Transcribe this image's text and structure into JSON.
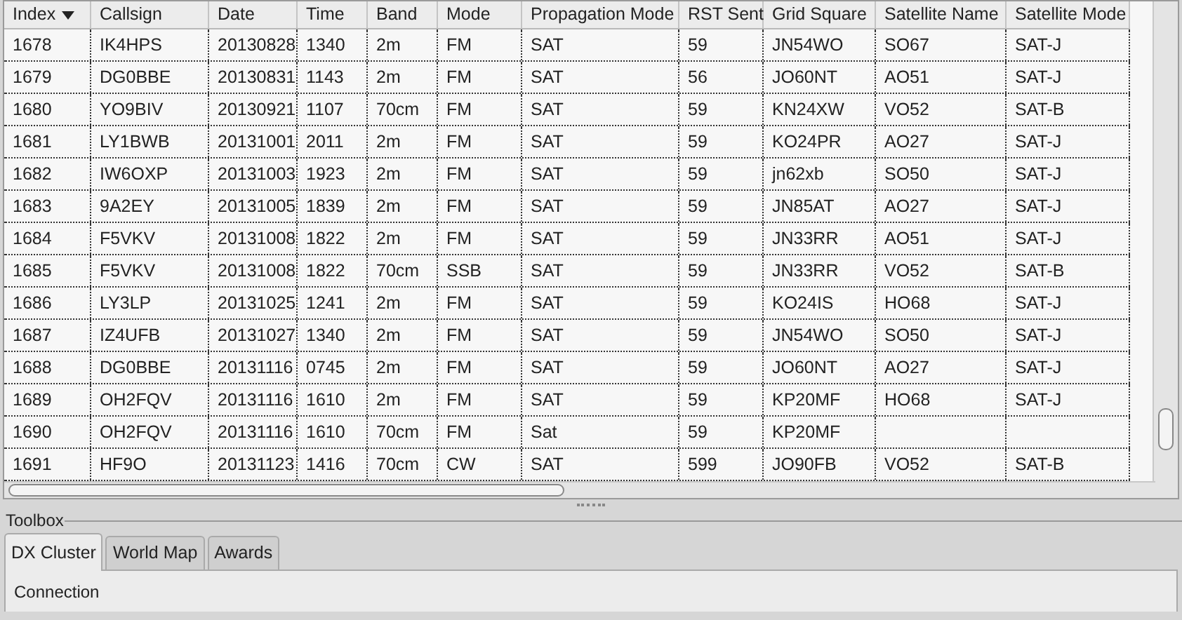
{
  "table": {
    "columns": [
      {
        "label": "Index",
        "sorted": true
      },
      {
        "label": "Callsign",
        "sorted": false
      },
      {
        "label": "Date",
        "sorted": false
      },
      {
        "label": "Time",
        "sorted": false
      },
      {
        "label": "Band",
        "sorted": false
      },
      {
        "label": "Mode",
        "sorted": false
      },
      {
        "label": "Propagation Mode",
        "sorted": false
      },
      {
        "label": "RST Sent",
        "sorted": false
      },
      {
        "label": "Grid Square",
        "sorted": false
      },
      {
        "label": "Satellite Name",
        "sorted": false
      },
      {
        "label": "Satellite Mode",
        "sorted": false
      }
    ],
    "rows": [
      [
        "1678",
        "IK4HPS",
        "20130828",
        "1340",
        "2m",
        "FM",
        "SAT",
        "59",
        "JN54WO",
        "SO67",
        "SAT-J"
      ],
      [
        "1679",
        "DG0BBE",
        "20130831",
        "1143",
        "2m",
        "FM",
        "SAT",
        "56",
        "JO60NT",
        "AO51",
        "SAT-J"
      ],
      [
        "1680",
        "YO9BIV",
        "20130921",
        "1107",
        "70cm",
        "FM",
        "SAT",
        "59",
        "KN24XW",
        "VO52",
        "SAT-B"
      ],
      [
        "1681",
        "LY1BWB",
        "20131001",
        "2011",
        "2m",
        "FM",
        "SAT",
        "59",
        "KO24PR",
        "AO27",
        "SAT-J"
      ],
      [
        "1682",
        "IW6OXP",
        "20131003",
        "1923",
        "2m",
        "FM",
        "SAT",
        "59",
        "jn62xb",
        "SO50",
        "SAT-J"
      ],
      [
        "1683",
        "9A2EY",
        "20131005",
        "1839",
        "2m",
        "FM",
        "SAT",
        "59",
        "JN85AT",
        "AO27",
        "SAT-J"
      ],
      [
        "1684",
        "F5VKV",
        "20131008",
        "1822",
        "2m",
        "FM",
        "SAT",
        "59",
        "JN33RR",
        "AO51",
        "SAT-J"
      ],
      [
        "1685",
        "F5VKV",
        "20131008",
        "1822",
        "70cm",
        "SSB",
        "SAT",
        "59",
        "JN33RR",
        "VO52",
        "SAT-B"
      ],
      [
        "1686",
        "LY3LP",
        "20131025",
        "1241",
        "2m",
        "FM",
        "SAT",
        "59",
        "KO24IS",
        "HO68",
        "SAT-J"
      ],
      [
        "1687",
        "IZ4UFB",
        "20131027",
        "1340",
        "2m",
        "FM",
        "SAT",
        "59",
        "JN54WO",
        "SO50",
        "SAT-J"
      ],
      [
        "1688",
        "DG0BBE",
        "20131116",
        "0745",
        "2m",
        "FM",
        "SAT",
        "59",
        "JO60NT",
        "AO27",
        "SAT-J"
      ],
      [
        "1689",
        "OH2FQV",
        "20131116",
        "1610",
        "2m",
        "FM",
        "SAT",
        "59",
        "KP20MF",
        "HO68",
        "SAT-J"
      ],
      [
        "1690",
        "OH2FQV",
        "20131116",
        "1610",
        "70cm",
        "FM",
        "Sat",
        "59",
        "KP20MF",
        "",
        ""
      ],
      [
        "1691",
        "HF9O",
        "20131123",
        "1416",
        "70cm",
        "CW",
        "SAT",
        "599",
        "JO90FB",
        "VO52",
        "SAT-B"
      ]
    ]
  },
  "toolbox": {
    "title": "Toolbox",
    "tabs": [
      {
        "label": "DX Cluster",
        "selected": true
      },
      {
        "label": "World Map",
        "selected": false
      },
      {
        "label": "Awards",
        "selected": false
      }
    ],
    "panel": {
      "label": "Connection"
    }
  }
}
